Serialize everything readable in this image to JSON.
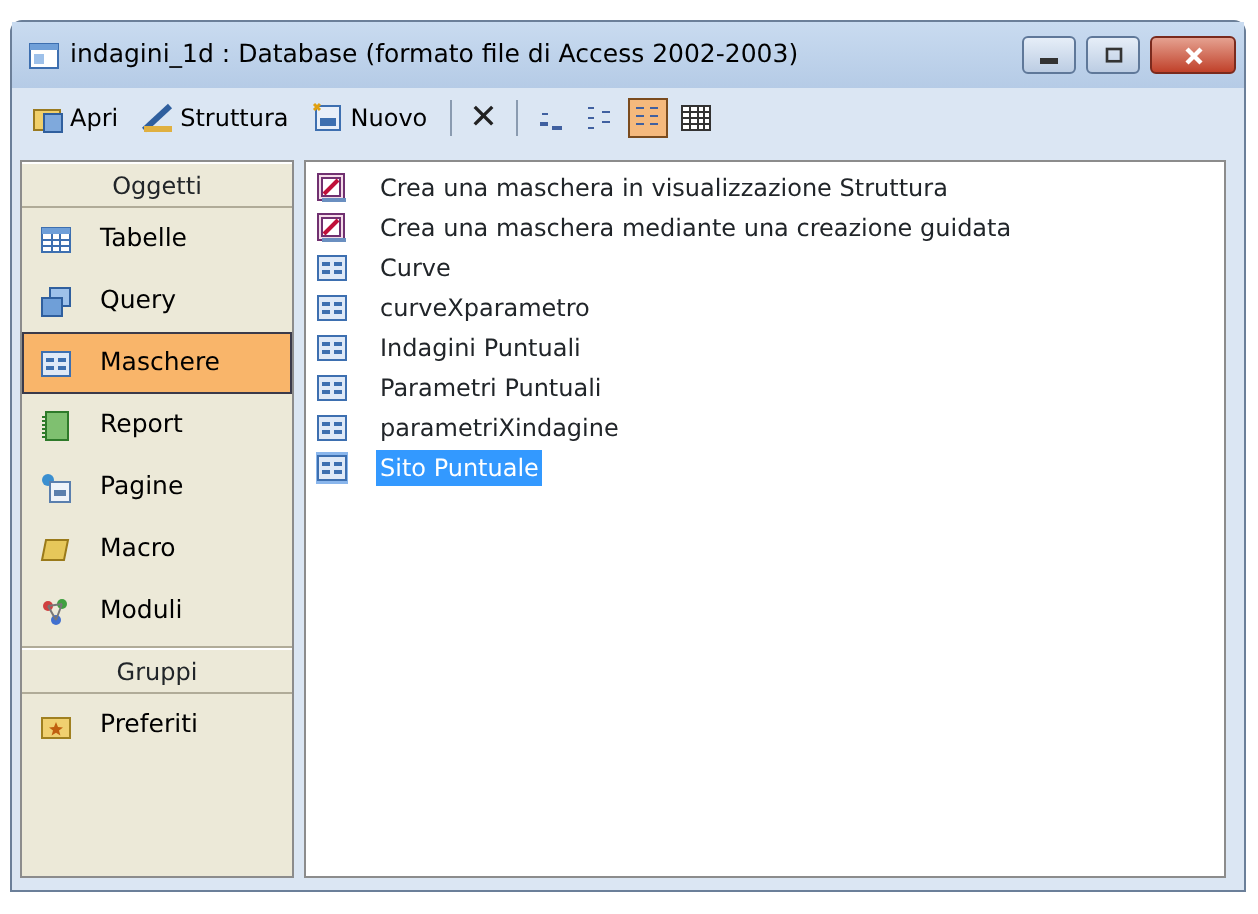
{
  "window": {
    "title": "indagini_1d : Database (formato file di Access 2002-2003)"
  },
  "toolbar": {
    "buttons": [
      {
        "label": "Apri",
        "kind": "open"
      },
      {
        "label": "Struttura",
        "kind": "design"
      },
      {
        "label": "Nuovo",
        "kind": "new"
      }
    ],
    "delete_label": "✕",
    "views": [
      {
        "kind": "large",
        "selected": false
      },
      {
        "kind": "small",
        "selected": false
      },
      {
        "kind": "list",
        "selected": true
      },
      {
        "kind": "details",
        "selected": false
      }
    ]
  },
  "sidebar": {
    "sections": [
      {
        "title": "Oggetti",
        "items": [
          {
            "label": "Tabelle",
            "kind": "table",
            "selected": false
          },
          {
            "label": "Query",
            "kind": "query",
            "selected": false
          },
          {
            "label": "Maschere",
            "kind": "form",
            "selected": true
          },
          {
            "label": "Report",
            "kind": "report",
            "selected": false
          },
          {
            "label": "Pagine",
            "kind": "page",
            "selected": false
          },
          {
            "label": "Macro",
            "kind": "macro",
            "selected": false
          },
          {
            "label": "Moduli",
            "kind": "module",
            "selected": false
          }
        ]
      },
      {
        "title": "Gruppi",
        "items": [
          {
            "label": "Preferiti",
            "kind": "favorites",
            "selected": false
          }
        ]
      }
    ]
  },
  "objects": [
    {
      "label": "Crea una maschera in visualizzazione Struttura",
      "kind": "wizard",
      "selected": false
    },
    {
      "label": "Crea una maschera mediante una creazione guidata",
      "kind": "wizard",
      "selected": false
    },
    {
      "label": "Curve",
      "kind": "form",
      "selected": false
    },
    {
      "label": "curveXparametro",
      "kind": "form",
      "selected": false
    },
    {
      "label": "Indagini Puntuali",
      "kind": "form",
      "selected": false
    },
    {
      "label": "Parametri Puntuali",
      "kind": "form",
      "selected": false
    },
    {
      "label": "parametriXindagine",
      "kind": "form",
      "selected": false
    },
    {
      "label": "Sito Puntuale",
      "kind": "form",
      "selected": true
    }
  ]
}
